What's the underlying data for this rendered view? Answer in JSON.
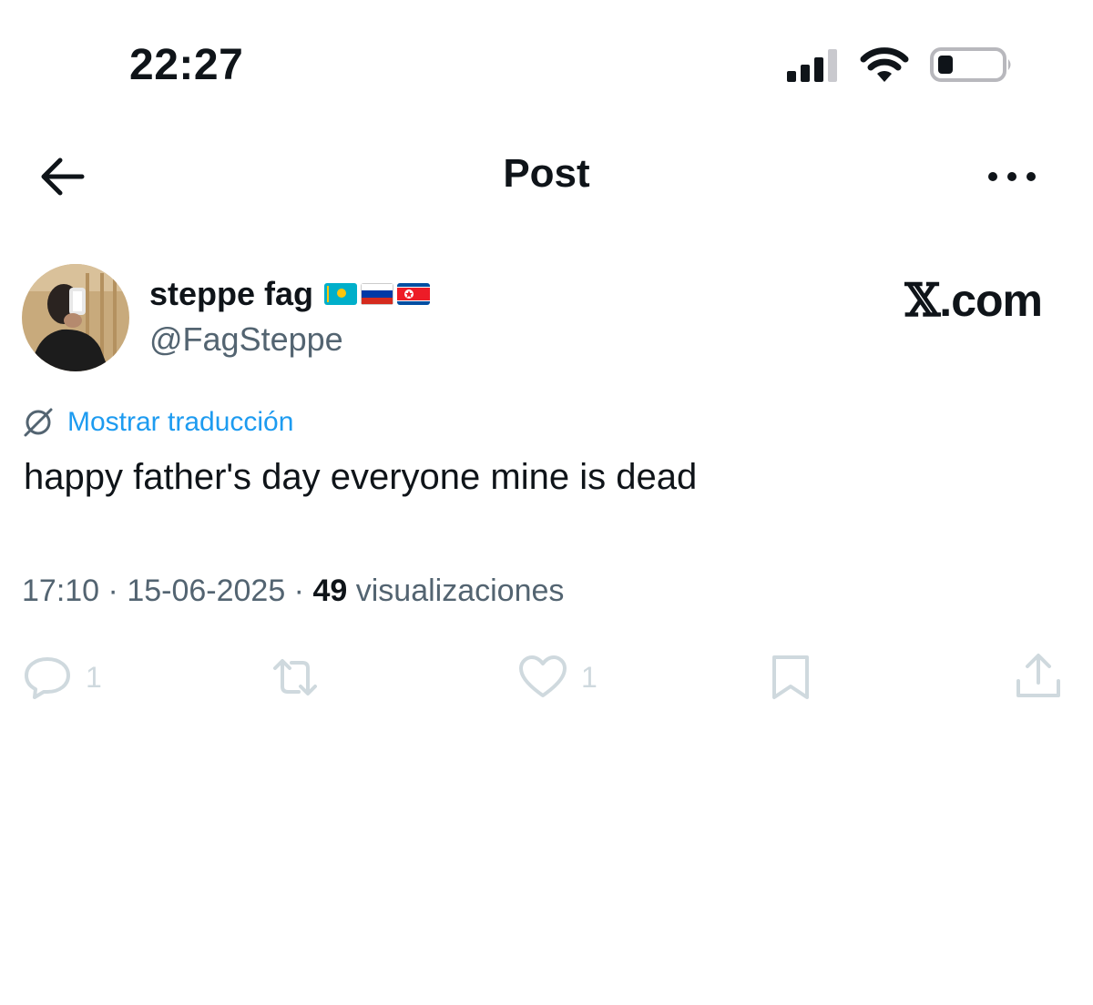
{
  "status_bar": {
    "time": "22:27"
  },
  "header": {
    "title": "Post"
  },
  "author": {
    "display_name": "steppe fag",
    "flags": [
      "Kazakhstan flag",
      "Russia flag",
      "North Korea flag"
    ],
    "handle": "@FagSteppe"
  },
  "watermark": {
    "brand": "𝕏",
    "suffix": ".com"
  },
  "post": {
    "translate_label": "Mostrar traducción",
    "text": "happy father's day everyone mine is dead",
    "time": "17:10",
    "separator": " · ",
    "date": "15-06-2025",
    "views_count": "49",
    "views_label": "visualizaciones"
  },
  "actions": {
    "reply_count": "1",
    "like_count": "1"
  },
  "colors": {
    "text": "#0f1419",
    "muted": "#536471",
    "link": "#1d9bf0",
    "action_faded": "#cfd9de"
  },
  "icons": {
    "back": "arrow-left-icon",
    "more": "more-dots-icon",
    "translate": "globe-slash-icon",
    "reply": "reply-bubble-icon",
    "repost": "repost-icon",
    "like": "heart-icon",
    "bookmark": "bookmark-icon",
    "share": "share-upload-icon"
  }
}
